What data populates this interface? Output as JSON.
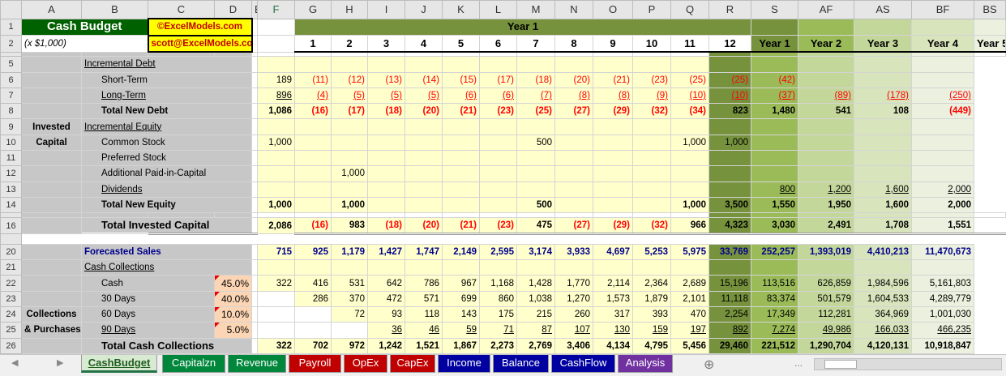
{
  "columns": [
    "A",
    "B",
    "C",
    "D",
    "E",
    "F",
    "G",
    "H",
    "I",
    "J",
    "K",
    "L",
    "M",
    "N",
    "O",
    "P",
    "Q",
    "R",
    "S",
    "AF",
    "AS",
    "BF",
    "BS"
  ],
  "header": {
    "title": "Cash Budget",
    "units": "(x $1,000)",
    "credit1": "©ExcelModels.com",
    "credit2": "scott@ExcelModels.com",
    "year_band": "Year 1",
    "periods": [
      "1",
      "2",
      "3",
      "4",
      "5",
      "6",
      "7",
      "8",
      "9",
      "10",
      "11",
      "12"
    ],
    "year_cols": [
      "Year 1",
      "Year 2",
      "Year 3",
      "Year 4",
      "Year 5"
    ]
  },
  "rows": {
    "r5": {
      "num": "5",
      "label": "Incremental Debt"
    },
    "r6": {
      "num": "6",
      "label": "Short-Term",
      "vals": [
        "189",
        "(11)",
        "(12)",
        "(13)",
        "(14)",
        "(15)",
        "(17)",
        "(18)",
        "(20)",
        "(21)",
        "(23)",
        "(25)",
        "(25)",
        "(42)",
        "",
        "",
        ""
      ]
    },
    "r7": {
      "num": "7",
      "label": "Long-Term",
      "vals": [
        "896",
        "(4)",
        "(5)",
        "(5)",
        "(5)",
        "(6)",
        "(6)",
        "(7)",
        "(8)",
        "(8)",
        "(9)",
        "(10)",
        "(10)",
        "(37)",
        "(89)",
        "(178)",
        "(250)"
      ]
    },
    "r8": {
      "num": "8",
      "label": "Total New Debt",
      "vals": [
        "1,086",
        "(16)",
        "(17)",
        "(18)",
        "(20)",
        "(21)",
        "(23)",
        "(25)",
        "(27)",
        "(29)",
        "(32)",
        "(34)",
        "823",
        "1,480",
        "541",
        "108",
        "(449)"
      ]
    },
    "r9": {
      "num": "9",
      "label": "Incremental Equity",
      "side": "Invested"
    },
    "r10": {
      "num": "10",
      "label": "Common Stock",
      "side": "Capital",
      "vals": [
        "1,000",
        "",
        "",
        "",
        "",
        "",
        "",
        "500",
        "",
        "",
        "",
        "1,000",
        "1,000",
        "",
        "",
        "",
        ""
      ]
    },
    "r11": {
      "num": "11",
      "label": "Preferred Stock"
    },
    "r12": {
      "num": "12",
      "label": "Additional Paid-in-Capital",
      "vals": [
        "",
        "",
        "1,000",
        "",
        "",
        "",
        "",
        "",
        "",
        "",
        "",
        "",
        "",
        "",
        "",
        "",
        ""
      ]
    },
    "r13": {
      "num": "13",
      "label": "Dividends",
      "vals": [
        "",
        "",
        "",
        "",
        "",
        "",
        "",
        "",
        "",
        "",
        "",
        "",
        "",
        "800",
        "1,200",
        "1,600",
        "2,000"
      ]
    },
    "r14": {
      "num": "14",
      "label": "Total New Equity",
      "vals": [
        "1,000",
        "",
        "1,000",
        "",
        "",
        "",
        "",
        "500",
        "",
        "",
        "",
        "1,000",
        "3,500",
        "1,550",
        "1,950",
        "1,600",
        "2,000"
      ]
    },
    "r16": {
      "num": "16",
      "label": "Total Invested Capital",
      "vals": [
        "2,086",
        "(16)",
        "983",
        "(18)",
        "(20)",
        "(21)",
        "(23)",
        "475",
        "(27)",
        "(29)",
        "(32)",
        "966",
        "4,323",
        "3,030",
        "2,491",
        "1,708",
        "1,551"
      ]
    },
    "r20": {
      "num": "20",
      "label": "Forecasted Sales",
      "vals": [
        "715",
        "925",
        "1,179",
        "1,427",
        "1,747",
        "2,149",
        "2,595",
        "3,174",
        "3,933",
        "4,697",
        "5,253",
        "5,975",
        "33,769",
        "252,257",
        "1,393,019",
        "4,410,213",
        "11,470,673"
      ]
    },
    "r21": {
      "num": "21",
      "label": "Cash Collections"
    },
    "r22": {
      "num": "22",
      "label": "Cash",
      "pct": "45.0%",
      "vals": [
        "322",
        "416",
        "531",
        "642",
        "786",
        "967",
        "1,168",
        "1,428",
        "1,770",
        "2,114",
        "2,364",
        "2,689",
        "15,196",
        "113,516",
        "626,859",
        "1,984,596",
        "5,161,803"
      ]
    },
    "r23": {
      "num": "23",
      "label": "30 Days",
      "pct": "40.0%",
      "vals": [
        "",
        "286",
        "370",
        "472",
        "571",
        "699",
        "860",
        "1,038",
        "1,270",
        "1,573",
        "1,879",
        "2,101",
        "11,118",
        "83,374",
        "501,579",
        "1,604,533",
        "4,289,779"
      ]
    },
    "r24": {
      "num": "24",
      "label": "60 Days",
      "pct": "10.0%",
      "side": "Collections",
      "vals": [
        "",
        "",
        "72",
        "93",
        "118",
        "143",
        "175",
        "215",
        "260",
        "317",
        "393",
        "470",
        "2,254",
        "17,349",
        "112,281",
        "364,969",
        "1,001,030"
      ]
    },
    "r25": {
      "num": "25",
      "label": "90 Days",
      "pct": "5.0%",
      "side": "& Purchases",
      "vals": [
        "",
        "",
        "",
        "36",
        "46",
        "59",
        "71",
        "87",
        "107",
        "130",
        "159",
        "197",
        "892",
        "7,274",
        "49,986",
        "166,033",
        "466,235"
      ]
    },
    "r26": {
      "num": "26",
      "label": "Total Cash Collections",
      "vals": [
        "322",
        "702",
        "972",
        "1,242",
        "1,521",
        "1,867",
        "2,273",
        "2,769",
        "3,406",
        "4,134",
        "4,795",
        "5,456",
        "29,460",
        "221,512",
        "1,290,704",
        "4,120,131",
        "10,918,847"
      ]
    }
  },
  "sheet_tabs": [
    {
      "label": "CashBudget",
      "color": "#d9ead3",
      "active": true
    },
    {
      "label": "Capitalzn",
      "color": "#00873c"
    },
    {
      "label": "Revenue",
      "color": "#00873c"
    },
    {
      "label": "Payroll",
      "color": "#c00000"
    },
    {
      "label": "OpEx",
      "color": "#c00000"
    },
    {
      "label": "CapEx",
      "color": "#c00000"
    },
    {
      "label": "Income",
      "color": "#0000a0"
    },
    {
      "label": "Balance",
      "color": "#0000a0"
    },
    {
      "label": "CashFlow",
      "color": "#0000a0"
    },
    {
      "label": "Analysis",
      "color": "#7030a0"
    }
  ],
  "misc": {
    "ellipsis": "...",
    "plus": "⊕",
    "prev": "◀",
    "next": "▶",
    "row_collapsed": [
      "3",
      "4",
      "15",
      "17",
      "18",
      "19"
    ]
  }
}
